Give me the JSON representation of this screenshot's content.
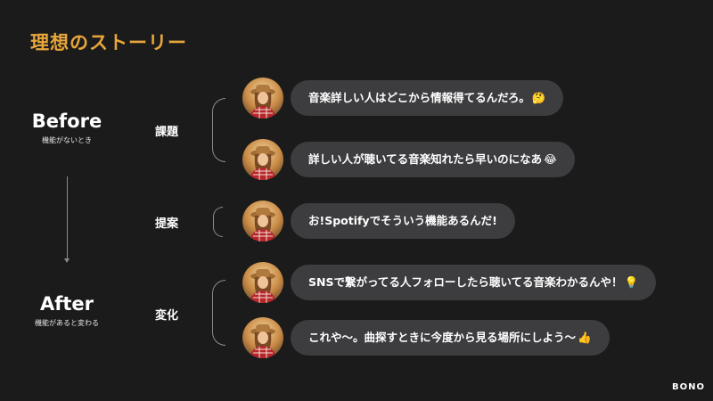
{
  "title": "理想のストーリー",
  "before": {
    "label": "Before",
    "sub": "機能がないとき"
  },
  "after": {
    "label": "After",
    "sub": "機能があると変わる"
  },
  "sections": [
    {
      "label": "課題"
    },
    {
      "label": "提案"
    },
    {
      "label": "変化"
    }
  ],
  "messages": [
    {
      "text": "音楽詳しい人はどこから情報得てるんだろ。",
      "emoji": "🤔"
    },
    {
      "text": "詳しい人が聴いてる音楽知れたら早いのになあ",
      "emoji": "😂"
    },
    {
      "text": "お!Spotifyでそういう機能あるんだ!",
      "emoji": ""
    },
    {
      "text": "SNSで繋がってる人フォローしたら聴いてる音楽わかるんや！",
      "emoji": "💡"
    },
    {
      "text": "これや〜。曲探すときに今度から見る場所にしよう〜",
      "emoji": "👍"
    }
  ],
  "brand": "BONO"
}
